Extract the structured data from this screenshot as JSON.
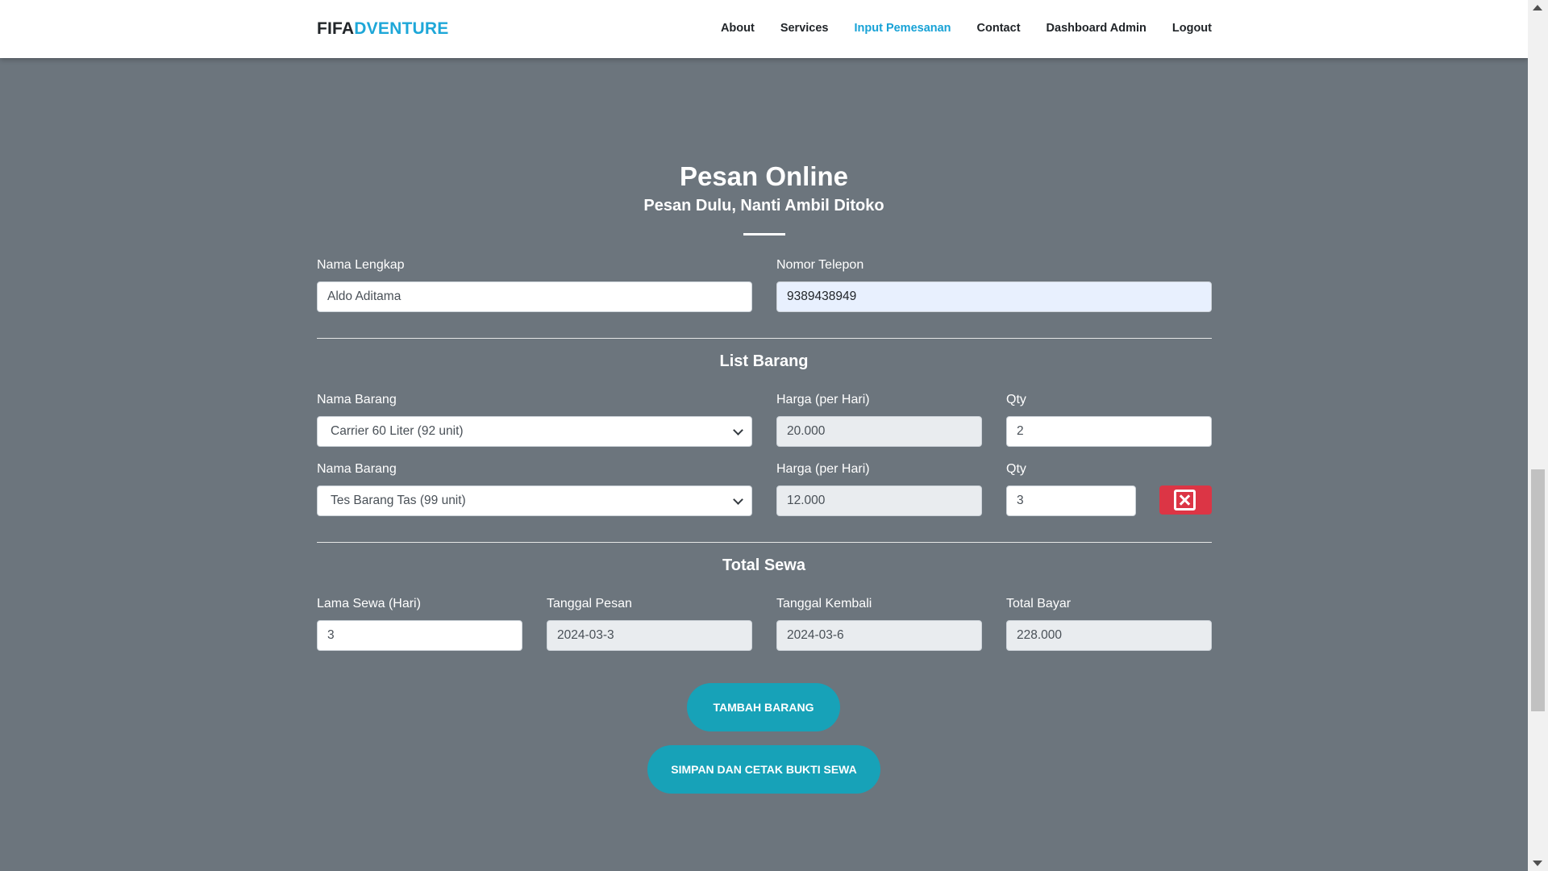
{
  "navbar": {
    "brand_part1": "FIFA",
    "brand_part2": "DVENTURE",
    "links": [
      "About",
      "Services",
      "Input Pemesanan",
      "Contact",
      "Dashboard Admin",
      "Logout"
    ],
    "active_link": "Input Pemesanan"
  },
  "header": {
    "title": "Pesan Online",
    "subtitle": "Pesan Dulu, Nanti Ambil Ditoko"
  },
  "customer": {
    "name_label": "Nama Lengkap",
    "name_value": "Aldo Aditama",
    "phone_label": "Nomor Telepon",
    "phone_value": "9389438949"
  },
  "items_section": {
    "title": "List Barang",
    "rows": [
      {
        "name_label": "Nama Barang",
        "name_value": "Carrier 60 Liter (92 unit)",
        "price_label": "Harga (per Hari)",
        "price_value": "20.000",
        "qty_label": "Qty",
        "qty_value": "2"
      },
      {
        "name_label": "Nama Barang",
        "name_value": "Tes Barang Tas (99 unit)",
        "price_label": "Harga (per Hari)",
        "price_value": "12.000",
        "qty_label": "Qty",
        "qty_value": "3"
      }
    ]
  },
  "total_section": {
    "title": "Total Sewa",
    "duration_label": "Lama Sewa (Hari)",
    "duration_value": "3",
    "order_date_label": "Tanggal Pesan",
    "order_date_value": "2024-03-3",
    "return_date_label": "Tanggal Kembali",
    "return_date_value": "2024-03-6",
    "total_label": "Total Bayar",
    "total_value": "228.000"
  },
  "actions": {
    "add_item": "TAMBAH BARANG",
    "save_print": "SIMPAN DAN CETAK BUKTI SEWA"
  },
  "colors": {
    "background": "#6c757d",
    "accent": "#17a2b8",
    "brand_accent": "#1ea7d8",
    "danger": "#dc3545"
  }
}
